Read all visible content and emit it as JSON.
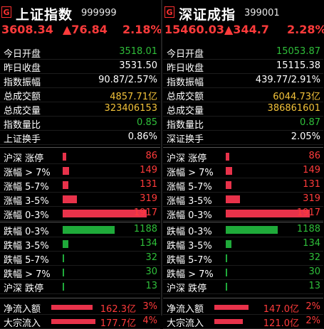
{
  "left": {
    "badge": "G",
    "name": "上证指数",
    "code": "999999",
    "price": "3608.34",
    "change": "▲76.84",
    "change_pct": "2.18%",
    "stats": [
      {
        "label": "今日开盘",
        "value": "3518.01",
        "color": "green"
      },
      {
        "label": "昨日收盘",
        "value": "3531.50",
        "color": "white"
      },
      {
        "label": "指数振幅",
        "value": "90.87/2.57%",
        "color": "white"
      },
      {
        "label": "总成交额",
        "value": "4857.71亿",
        "color": "yellow"
      },
      {
        "label": "总成交量",
        "value": "323406153",
        "color": "yellow"
      },
      {
        "label": "指数量比",
        "value": "0.85",
        "color": "green"
      },
      {
        "label": "上证换手",
        "value": "0.86%",
        "color": "white"
      }
    ],
    "up_rows": [
      {
        "label": "沪深 涨停",
        "value": "86",
        "bar_fraction": 0.045
      },
      {
        "label": "涨幅 > 7%",
        "value": "149",
        "bar_fraction": 0.078
      },
      {
        "label": "涨幅 5-7%",
        "value": "131",
        "bar_fraction": 0.068
      },
      {
        "label": "涨幅 3-5%",
        "value": "319",
        "bar_fraction": 0.166
      },
      {
        "label": "涨幅 0-3%",
        "value": "1917",
        "bar_fraction": 1.0
      }
    ],
    "down_rows": [
      {
        "label": "跌幅 0-3%",
        "value": "1188",
        "bar_fraction": 0.62
      },
      {
        "label": "跌幅 3-5%",
        "value": "134",
        "bar_fraction": 0.07
      },
      {
        "label": "跌幅 5-7%",
        "value": "32",
        "bar_fraction": 0.017
      },
      {
        "label": "跌幅 > 7%",
        "value": "30",
        "bar_fraction": 0.016
      },
      {
        "label": "沪深 跌停",
        "value": "13",
        "bar_fraction": 0.007
      }
    ],
    "flow_rows": [
      {
        "label": "净流入额",
        "value": "162.3亿",
        "pct": "3%",
        "bar_fraction": 0.93
      },
      {
        "label": "大宗流入",
        "value": "177.7亿",
        "pct": "4%",
        "bar_fraction": 1.0
      }
    ]
  },
  "right": {
    "badge": "G",
    "name": "深证成指",
    "code": "399001",
    "price": "15460.03",
    "change": "▲344.7",
    "change_pct": "2.28%",
    "stats": [
      {
        "label": "今日开盘",
        "value": "15053.87",
        "color": "green"
      },
      {
        "label": "昨日收盘",
        "value": "15115.38",
        "color": "white"
      },
      {
        "label": "指数振幅",
        "value": "439.77/2.91%",
        "color": "white"
      },
      {
        "label": "总成交额",
        "value": "6044.73亿",
        "color": "yellow"
      },
      {
        "label": "总成交量",
        "value": "386861601",
        "color": "yellow"
      },
      {
        "label": "指数量比",
        "value": "0.87",
        "color": "green"
      },
      {
        "label": "深证换手",
        "value": "2.05%",
        "color": "white"
      }
    ],
    "up_rows": [
      {
        "label": "沪深 涨停",
        "value": "86",
        "bar_fraction": 0.045
      },
      {
        "label": "涨幅 > 7%",
        "value": "149",
        "bar_fraction": 0.078
      },
      {
        "label": "涨幅 5-7%",
        "value": "131",
        "bar_fraction": 0.068
      },
      {
        "label": "涨幅 3-5%",
        "value": "319",
        "bar_fraction": 0.166
      },
      {
        "label": "涨幅 0-3%",
        "value": "1917",
        "bar_fraction": 1.0
      }
    ],
    "down_rows": [
      {
        "label": "跌幅 0-3%",
        "value": "1188",
        "bar_fraction": 0.62
      },
      {
        "label": "跌幅 3-5%",
        "value": "134",
        "bar_fraction": 0.07
      },
      {
        "label": "跌幅 5-7%",
        "value": "32",
        "bar_fraction": 0.017
      },
      {
        "label": "跌幅 > 7%",
        "value": "30",
        "bar_fraction": 0.016
      },
      {
        "label": "沪深 跌停",
        "value": "13",
        "bar_fraction": 0.007
      }
    ],
    "flow_rows": [
      {
        "label": "净流入额",
        "value": "147.0亿",
        "pct": "2%",
        "bar_fraction": 0.78
      },
      {
        "label": "大宗流入",
        "value": "121.0亿",
        "pct": "2%",
        "bar_fraction": 0.64
      }
    ]
  }
}
